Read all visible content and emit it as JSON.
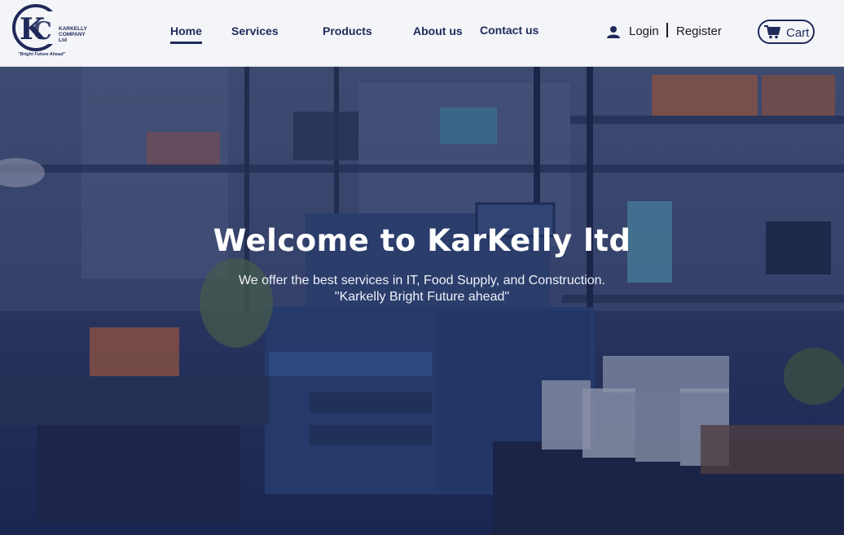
{
  "brand": {
    "logo_letters": "K",
    "logo_line1": "KARKELLY",
    "logo_line2": "COMPANY Ltd",
    "tagline": "\"Bright Future Ahead\""
  },
  "nav": {
    "items": [
      {
        "label": "Home",
        "active": true
      },
      {
        "label": "Services",
        "active": false
      },
      {
        "label": "Products",
        "active": false
      },
      {
        "label": "About us",
        "active": false
      },
      {
        "label": "Contact us",
        "active": false
      }
    ]
  },
  "auth": {
    "login": "Login",
    "register": "Register"
  },
  "cart": {
    "label": "Cart"
  },
  "hero": {
    "title": "Welcome to KarKelly ltd",
    "subtitle_line1": "We offer the best services in IT, Food Supply, and Construction.",
    "subtitle_line2": "\"Karkelly Bright Future ahead\""
  },
  "colors": {
    "brand_navy": "#1f2a5a",
    "header_bg": "#f4f5f8",
    "hero_overlay": "#1b2650"
  }
}
